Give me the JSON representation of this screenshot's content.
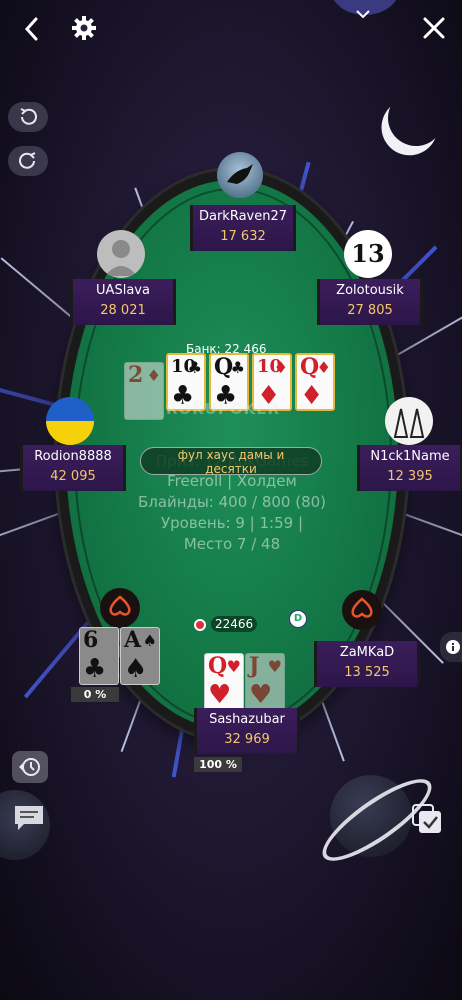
{
  "topbar": {
    "back_icon": "chevron-left-icon",
    "settings_icon": "gear-icon",
    "close_icon": "close-icon",
    "collapse_icon": "chevron-down-icon"
  },
  "side_buttons": {
    "undo_icon": "undo-icon",
    "redo_icon": "redo-icon",
    "history_icon": "history-icon",
    "chat_icon": "chat-icon",
    "info_icon": "info-icon",
    "multi_table_icon": "multi-table-icon"
  },
  "table": {
    "bank_label": "Банк: 22 466",
    "hand_result": "фул хаус дамы и десятки",
    "info_line1": "Приз: 12 RokGames",
    "info_line2": "Freeroll | Холдем",
    "info_line3": "Блайнды: 400 / 800 (80)",
    "info_line4": "Уровень: 9 | 1:59 |",
    "info_line5": "Место 7 / 48",
    "logo": "ROKUPOKER",
    "pot_amount": "22466",
    "dealer_label": "D"
  },
  "board": [
    {
      "rank": "2",
      "suit": "♦",
      "color": "red",
      "highlighted": false
    },
    {
      "rank": "10",
      "suit": "♣",
      "color": "black",
      "highlighted": true
    },
    {
      "rank": "Q",
      "suit": "♣",
      "color": "black",
      "highlighted": true
    },
    {
      "rank": "10",
      "suit": "♦",
      "color": "red",
      "highlighted": true
    },
    {
      "rank": "Q",
      "suit": "♦",
      "color": "red",
      "highlighted": true
    }
  ],
  "players": {
    "p1": {
      "name": "DarkRaven27",
      "stack": "17 632"
    },
    "p2": {
      "name": "UASlava",
      "stack": "28 021"
    },
    "p3": {
      "name": "Zolotousik",
      "stack": "27 805"
    },
    "p4": {
      "name": "Rodion8888",
      "stack": "42 095"
    },
    "p5": {
      "name": "N1ck1Name",
      "stack": "12 395"
    },
    "p6": {
      "name": "ZaMKaD",
      "stack": "13 525"
    },
    "hero": {
      "name": "Sashazubar",
      "stack": "32 969",
      "equity": "100 %"
    },
    "left_hand": {
      "equity": "0 %"
    }
  },
  "hero_cards": [
    {
      "rank": "Q",
      "suit": "♥"
    },
    {
      "rank": "J",
      "suit": "♥"
    }
  ],
  "left_cards": [
    {
      "rank": "6",
      "suit": "♣"
    },
    {
      "rank": "A",
      "suit": "♠"
    }
  ],
  "avatar_p3_text": "13",
  "colors": {
    "felt": "#137846",
    "panel": "#2c1648",
    "stack": "#f3c86b"
  }
}
